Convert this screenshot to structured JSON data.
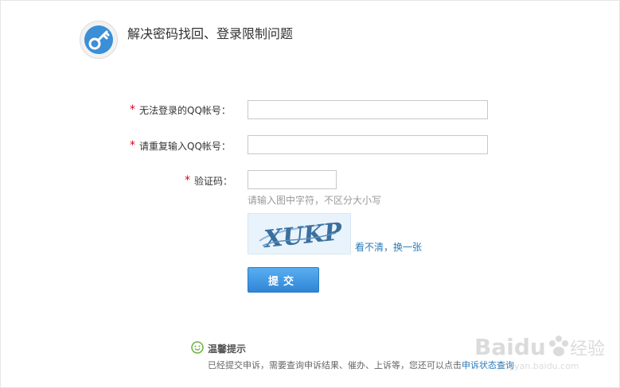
{
  "header": {
    "title": "解决密码找回、登录限制问题",
    "icon": "key-icon"
  },
  "form": {
    "required_mark": "*",
    "qq_label": "无法登录的QQ帐号：",
    "qq_value": "",
    "qq_repeat_label": "请重复输入QQ帐号：",
    "qq_repeat_value": "",
    "captcha_label": "验证码：",
    "captcha_value": "",
    "captcha_hint": "请输入图中字符，不区分大小写",
    "captcha_text": "XUKP",
    "refresh_label": "看不清，换一张",
    "submit_label": "提交"
  },
  "tip": {
    "title": "温馨提示",
    "body": "已经提交申诉，需要查询申诉结果、催办、上诉等，您还可以点击",
    "link": "申诉状态查询"
  },
  "watermark": {
    "brand": "Baidu",
    "cn": "经验",
    "url": "jingyan.baidu.com"
  },
  "colors": {
    "accent": "#3b8fd6",
    "required": "#d9001b",
    "link": "#2a7ab8",
    "tip_icon": "#6cb33f"
  }
}
